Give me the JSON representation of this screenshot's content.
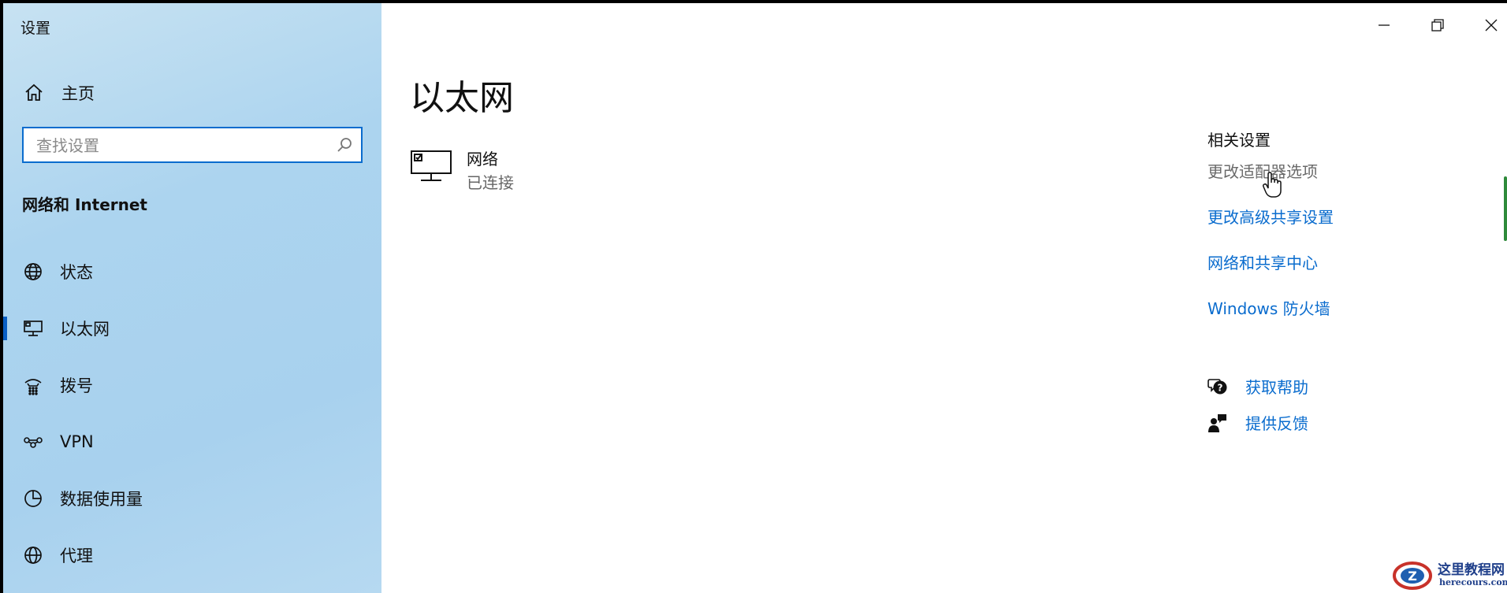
{
  "window": {
    "title": "设置"
  },
  "sidebar": {
    "home_label": "主页",
    "search_placeholder": "查找设置",
    "search_value": "",
    "section_title": "网络和 Internet",
    "items": [
      {
        "label": "状态",
        "icon": "globe-status-icon",
        "active": false
      },
      {
        "label": "以太网",
        "icon": "ethernet-icon",
        "active": true
      },
      {
        "label": "拨号",
        "icon": "dialup-icon",
        "active": false
      },
      {
        "label": "VPN",
        "icon": "vpn-icon",
        "active": false
      },
      {
        "label": "数据使用量",
        "icon": "data-usage-icon",
        "active": false
      },
      {
        "label": "代理",
        "icon": "globe-icon",
        "active": false
      }
    ]
  },
  "main": {
    "page_title": "以太网",
    "network": {
      "name": "网络",
      "status": "已连接",
      "icon": "network-computer-icon"
    },
    "related": {
      "title": "相关设置",
      "links": [
        {
          "label": "更改适配器选项",
          "hovered": true
        },
        {
          "label": "更改高级共享设置",
          "hovered": false
        },
        {
          "label": "网络和共享中心",
          "hovered": false
        },
        {
          "label": "Windows 防火墙",
          "hovered": false
        }
      ]
    },
    "help": [
      {
        "label": "获取帮助",
        "icon": "help-chat-icon"
      },
      {
        "label": "提供反馈",
        "icon": "feedback-icon"
      }
    ]
  },
  "window_controls": [
    "minimize-icon",
    "restore-icon",
    "close-icon"
  ],
  "watermark": {
    "text_cn": "这里教程网",
    "text_en": "herecours.com"
  },
  "colors": {
    "accent": "#0a6cce",
    "active_indicator": "#0a5fc4",
    "sidebar_bg": "#a8d1ee",
    "hovered_link": "#6a6a6a"
  }
}
